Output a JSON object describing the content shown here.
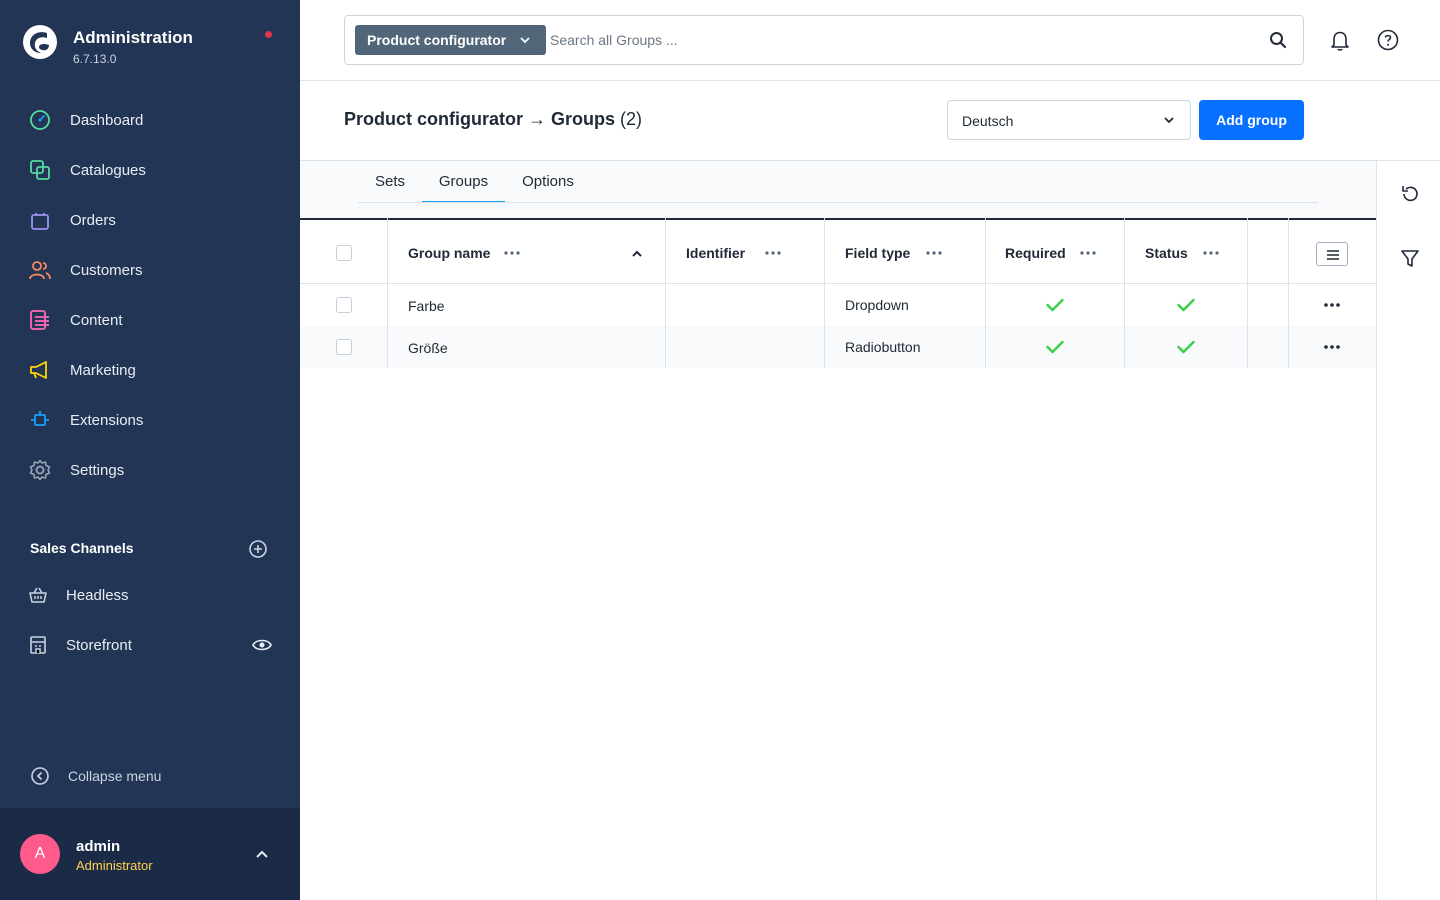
{
  "app": {
    "title": "Administration",
    "version": "6.7.13.0"
  },
  "nav": {
    "items": [
      {
        "label": "Dashboard",
        "icon": "dashboard-icon",
        "color": "#57d9a3"
      },
      {
        "label": "Catalogues",
        "icon": "catalogues-icon",
        "color": "#57d9a3"
      },
      {
        "label": "Orders",
        "icon": "orders-icon",
        "color": "#a092f0"
      },
      {
        "label": "Customers",
        "icon": "customers-icon",
        "color": "#f88962"
      },
      {
        "label": "Content",
        "icon": "content-icon",
        "color": "#ff68b4"
      },
      {
        "label": "Marketing",
        "icon": "marketing-icon",
        "color": "#ffd700"
      },
      {
        "label": "Extensions",
        "icon": "extensions-icon",
        "color": "#189eff"
      },
      {
        "label": "Settings",
        "icon": "settings-icon",
        "color": "#9aa8b5"
      }
    ],
    "sales_channels_title": "Sales Channels",
    "sales_channels": [
      {
        "label": "Headless",
        "icon": "basket-icon"
      },
      {
        "label": "Storefront",
        "icon": "storefront-icon"
      }
    ],
    "collapse_label": "Collapse menu"
  },
  "user": {
    "initial": "A",
    "name": "admin",
    "role": "Administrator"
  },
  "search": {
    "type_label": "Product configurator",
    "placeholder": "Search all Groups ..."
  },
  "header": {
    "title": "Product configurator → Groups",
    "count": "(2)",
    "language": "Deutsch",
    "add_button": "Add group"
  },
  "tabs": [
    {
      "label": "Sets",
      "active": false
    },
    {
      "label": "Groups",
      "active": true
    },
    {
      "label": "Options",
      "active": false
    }
  ],
  "table": {
    "columns": [
      "Group name",
      "Identifier",
      "Field type",
      "Required",
      "Status"
    ],
    "rows": [
      {
        "group_name": "Farbe",
        "identifier": "",
        "field_type": "Dropdown",
        "required": true,
        "status": true
      },
      {
        "group_name": "Größe",
        "identifier": "",
        "field_type": "Radiobutton",
        "required": true,
        "status": true
      }
    ]
  },
  "colors": {
    "sidebar_bg": "#233554",
    "accent": "#0870ff",
    "check": "#37d046",
    "tab_active": "#189eff"
  }
}
